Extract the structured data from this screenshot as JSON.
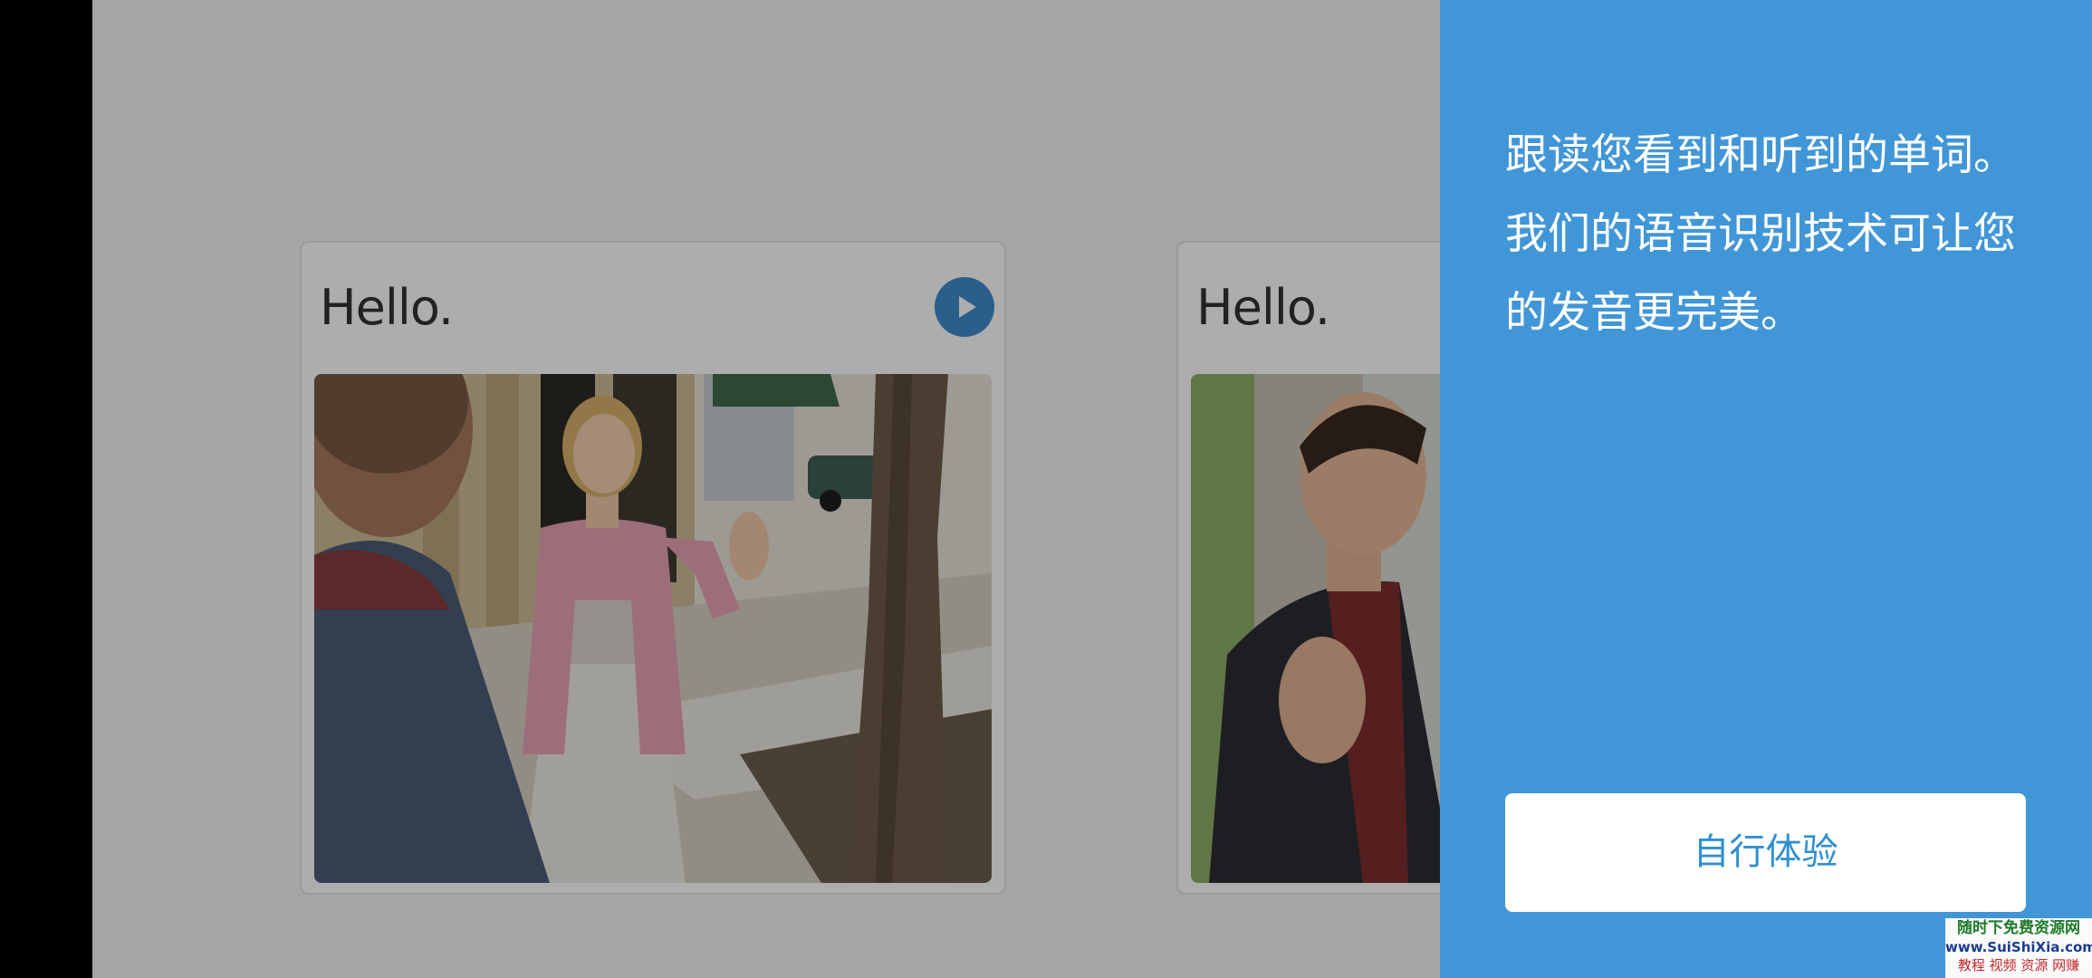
{
  "lesson": {
    "cards": [
      {
        "title": "Hello.",
        "has_audio": true,
        "image": "woman-waving-on-street-photo"
      },
      {
        "title": "Hello.",
        "has_audio": true,
        "image": "man-in-suit-waving-photo"
      }
    ]
  },
  "coach_panel": {
    "lines": [
      "跟读您看到和听到的单词。",
      "我们的语音识别技术可让您",
      "的发音更完美。"
    ],
    "button_label": "自行体验",
    "background_color": "#4196d7",
    "button_text_color": "#2f8fd0"
  },
  "icons": {
    "play": "play-icon"
  },
  "watermark": {
    "line1": "随时下免费资源网",
    "line2": "www.SuiShiXia.com",
    "line3": "教程 视频 资源 网赚"
  }
}
